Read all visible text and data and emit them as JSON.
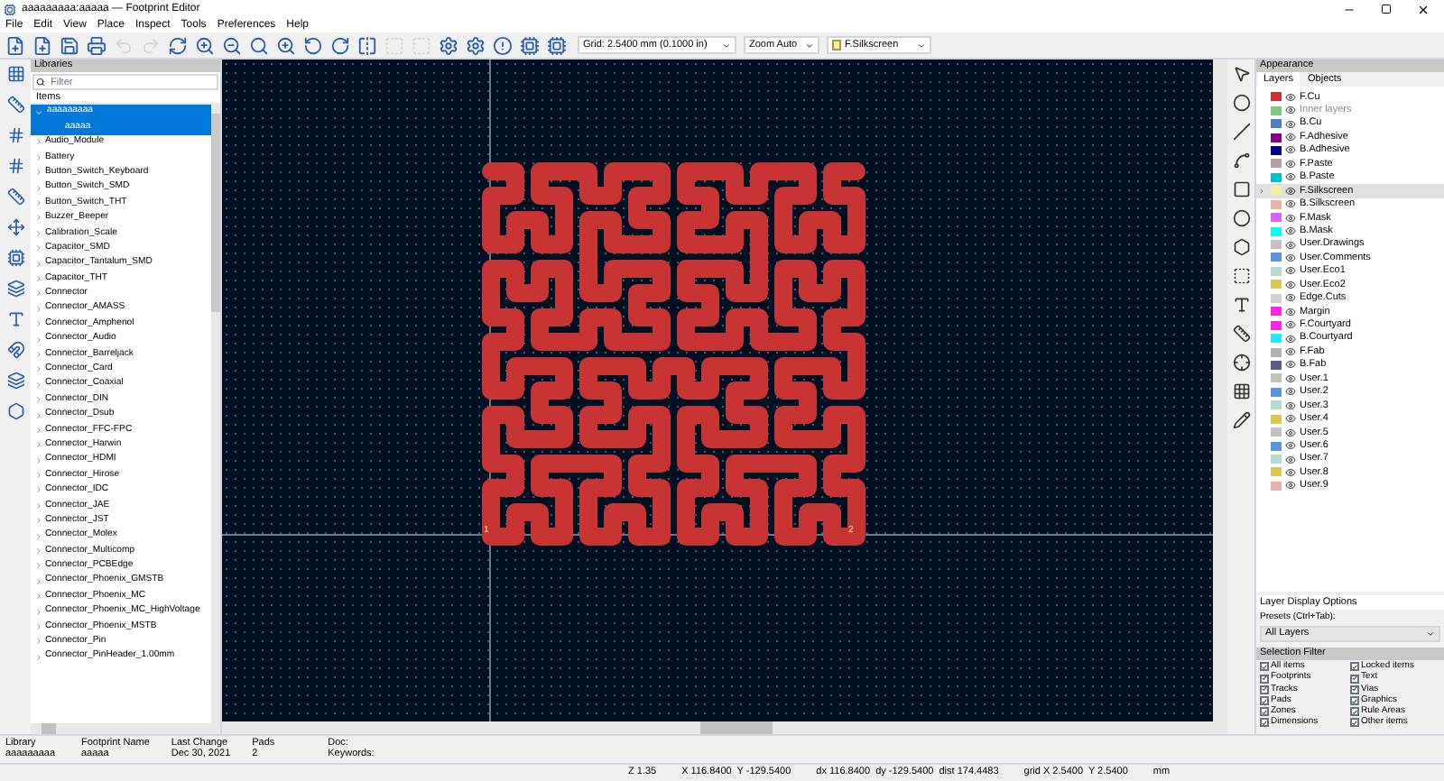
{
  "window": {
    "title": "aaaaaaaaa:aaaaa — Footprint Editor"
  },
  "menu": [
    "File",
    "Edit",
    "View",
    "Place",
    "Inspect",
    "Tools",
    "Preferences",
    "Help"
  ],
  "toolbar": {
    "grid": "Grid: 2.5400 mm (0.1000 in)",
    "zoom": "Zoom Auto",
    "layer": "F.Silkscreen"
  },
  "libraries": {
    "title": "Libraries",
    "filter_placeholder": "Filter",
    "column": "Items",
    "items": [
      {
        "name": "aaaaaaaaa",
        "expanded": true,
        "selected": true,
        "children": [
          {
            "name": "aaaaa",
            "selected": true
          }
        ]
      },
      {
        "name": "Audio_Module",
        "expanded": false,
        "selected": false
      },
      {
        "name": "Battery",
        "expanded": false,
        "selected": false
      },
      {
        "name": "Button_Switch_Keyboard",
        "expanded": false,
        "selected": false
      },
      {
        "name": "Button_Switch_SMD",
        "expanded": false,
        "selected": false
      },
      {
        "name": "Button_Switch_THT",
        "expanded": false,
        "selected": false
      },
      {
        "name": "Buzzer_Beeper",
        "expanded": false,
        "selected": false
      },
      {
        "name": "Calibration_Scale",
        "expanded": false,
        "selected": false
      },
      {
        "name": "Capacitor_SMD",
        "expanded": false,
        "selected": false
      },
      {
        "name": "Capacitor_Tantalum_SMD",
        "expanded": false,
        "selected": false
      },
      {
        "name": "Capacitor_THT",
        "expanded": false,
        "selected": false
      },
      {
        "name": "Connector",
        "expanded": false,
        "selected": false
      },
      {
        "name": "Connector_AMASS",
        "expanded": false,
        "selected": false
      },
      {
        "name": "Connector_Amphenol",
        "expanded": false,
        "selected": false
      },
      {
        "name": "Connector_Audio",
        "expanded": false,
        "selected": false
      },
      {
        "name": "Connector_Barreljack",
        "expanded": false,
        "selected": false
      },
      {
        "name": "Connector_Card",
        "expanded": false,
        "selected": false
      },
      {
        "name": "Connector_Coaxial",
        "expanded": false,
        "selected": false
      },
      {
        "name": "Connector_DIN",
        "expanded": false,
        "selected": false
      },
      {
        "name": "Connector_Dsub",
        "expanded": false,
        "selected": false
      },
      {
        "name": "Connector_FFC-FPC",
        "expanded": false,
        "selected": false
      },
      {
        "name": "Connector_Harwin",
        "expanded": false,
        "selected": false
      },
      {
        "name": "Connector_HDMI",
        "expanded": false,
        "selected": false
      },
      {
        "name": "Connector_Hirose",
        "expanded": false,
        "selected": false
      },
      {
        "name": "Connector_IDC",
        "expanded": false,
        "selected": false
      },
      {
        "name": "Connector_JAE",
        "expanded": false,
        "selected": false
      },
      {
        "name": "Connector_JST",
        "expanded": false,
        "selected": false
      },
      {
        "name": "Connector_Molex",
        "expanded": false,
        "selected": false
      },
      {
        "name": "Connector_Multicomp",
        "expanded": false,
        "selected": false
      },
      {
        "name": "Connector_PCBEdge",
        "expanded": false,
        "selected": false
      },
      {
        "name": "Connector_Phoenix_GMSTB",
        "expanded": false,
        "selected": false
      },
      {
        "name": "Connector_Phoenix_MC",
        "expanded": false,
        "selected": false
      },
      {
        "name": "Connector_Phoenix_MC_HighVoltage",
        "expanded": false,
        "selected": false
      },
      {
        "name": "Connector_Phoenix_MSTB",
        "expanded": false,
        "selected": false
      },
      {
        "name": "Connector_Pin",
        "expanded": false,
        "selected": false
      },
      {
        "name": "Connector_PinHeader_1.00mm",
        "expanded": false,
        "selected": false
      }
    ]
  },
  "appearance": {
    "title": "Appearance",
    "tabs": [
      {
        "label": "Layers",
        "selected": true
      },
      {
        "label": "Objects",
        "selected": false
      }
    ],
    "layers": [
      {
        "name": "F.Cu",
        "color": "#c83434",
        "selected": false,
        "dimmed": false
      },
      {
        "name": "Inner layers",
        "color": "#7fc87f",
        "selected": false,
        "dimmed": true
      },
      {
        "name": "B.Cu",
        "color": "#4d7fc4",
        "selected": false,
        "dimmed": false
      },
      {
        "name": "F.Adhesive",
        "color": "#840084",
        "selected": false,
        "dimmed": false
      },
      {
        "name": "B.Adhesive",
        "color": "#000084",
        "selected": false,
        "dimmed": false
      },
      {
        "name": "F.Paste",
        "color": "#b4a0a0",
        "selected": false,
        "dimmed": false
      },
      {
        "name": "B.Paste",
        "color": "#00c2c2",
        "selected": false,
        "dimmed": false
      },
      {
        "name": "F.Silkscreen",
        "color": "#f2eda1",
        "selected": true,
        "dimmed": false
      },
      {
        "name": "B.Silkscreen",
        "color": "#e8b2a7",
        "selected": false,
        "dimmed": false
      },
      {
        "name": "F.Mask",
        "color": "#d864ff",
        "selected": false,
        "dimmed": false
      },
      {
        "name": "B.Mask",
        "color": "#02ffee",
        "selected": false,
        "dimmed": false
      },
      {
        "name": "User.Drawings",
        "color": "#c2c2c2",
        "selected": false,
        "dimmed": false
      },
      {
        "name": "User.Comments",
        "color": "#5994dc",
        "selected": false,
        "dimmed": false
      },
      {
        "name": "User.Eco1",
        "color": "#b4dbd2",
        "selected": false,
        "dimmed": false
      },
      {
        "name": "User.Eco2",
        "color": "#d8c852",
        "selected": false,
        "dimmed": false
      },
      {
        "name": "Edge.Cuts",
        "color": "#d0d2cd",
        "selected": false,
        "dimmed": false
      },
      {
        "name": "Margin",
        "color": "#ff26e2",
        "selected": false,
        "dimmed": false
      },
      {
        "name": "F.Courtyard",
        "color": "#ff26e2",
        "selected": false,
        "dimmed": false
      },
      {
        "name": "B.Courtyard",
        "color": "#26e9ff",
        "selected": false,
        "dimmed": false
      },
      {
        "name": "F.Fab",
        "color": "#afafaf",
        "selected": false,
        "dimmed": false
      },
      {
        "name": "B.Fab",
        "color": "#585d84",
        "selected": false,
        "dimmed": false
      },
      {
        "name": "User.1",
        "color": "#c2c2c2",
        "selected": false,
        "dimmed": false
      },
      {
        "name": "User.2",
        "color": "#5994dc",
        "selected": false,
        "dimmed": false
      },
      {
        "name": "User.3",
        "color": "#b4dbd2",
        "selected": false,
        "dimmed": false
      },
      {
        "name": "User.4",
        "color": "#d8c852",
        "selected": false,
        "dimmed": false
      },
      {
        "name": "User.5",
        "color": "#c2c2c2",
        "selected": false,
        "dimmed": false
      },
      {
        "name": "User.6",
        "color": "#5994dc",
        "selected": false,
        "dimmed": false
      },
      {
        "name": "User.7",
        "color": "#b4dbd2",
        "selected": false,
        "dimmed": false
      },
      {
        "name": "User.8",
        "color": "#d8c852",
        "selected": false,
        "dimmed": false
      },
      {
        "name": "User.9",
        "color": "#e8b2a7",
        "selected": false,
        "dimmed": false
      }
    ],
    "display_options": "Layer Display Options",
    "presets_label": "Presets (Ctrl+Tab):",
    "preset": "All Layers"
  },
  "selection_filter": {
    "title": "Selection Filter",
    "items": [
      {
        "label": "All items",
        "checked": true
      },
      {
        "label": "Locked items",
        "checked": true
      },
      {
        "label": "Footprints",
        "checked": true
      },
      {
        "label": "Text",
        "checked": true
      },
      {
        "label": "Tracks",
        "checked": true
      },
      {
        "label": "Vias",
        "checked": true
      },
      {
        "label": "Pads",
        "checked": true
      },
      {
        "label": "Graphics",
        "checked": true
      },
      {
        "label": "Zones",
        "checked": true
      },
      {
        "label": "Rule Areas",
        "checked": true
      },
      {
        "label": "Dimensions",
        "checked": true
      },
      {
        "label": "Other items",
        "checked": true
      }
    ]
  },
  "footprint_info": [
    {
      "label": "Library",
      "value": "aaaaaaaaa"
    },
    {
      "label": "Footprint Name",
      "value": "aaaaa"
    },
    {
      "label": "Last Change",
      "value": "Dec 30, 2021"
    },
    {
      "label": "Pads",
      "value": "2"
    },
    {
      "label": "Doc:",
      "value": "Keywords:"
    }
  ],
  "canvas": {
    "pads": [
      "1",
      "2"
    ]
  },
  "status_bar": [
    "Z 1.35",
    "X 116.8400  Y -129.5400",
    "dx 116.8400  dy -129.5400  dist 174.4483",
    "grid X 2.5400  Y 2.5400",
    "mm"
  ]
}
